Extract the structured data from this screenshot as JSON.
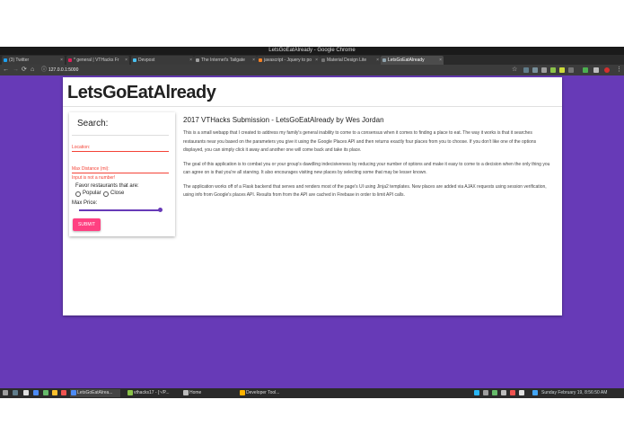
{
  "window": {
    "title": "LetsGoEatAlready - Google Chrome"
  },
  "tabs": [
    {
      "label": "(3) Twitter",
      "active": false
    },
    {
      "label": "* general | VTHacks Fr",
      "active": false
    },
    {
      "label": "Devpost",
      "active": false
    },
    {
      "label": "The Internet's Tailgate",
      "active": false
    },
    {
      "label": "javascript - Jquery to po",
      "active": false
    },
    {
      "label": "Material Design Lite",
      "active": false
    },
    {
      "label": "LetsGoEatAlready",
      "active": true
    }
  ],
  "address": {
    "url": "127.0.0.1:5000"
  },
  "app": {
    "brand": "LetsGoEatAlready"
  },
  "search": {
    "title": "Search:",
    "location_label": "Location:",
    "distance_label": "Max Distance (mi):",
    "distance_error": "Input is not a number!",
    "favor_label": "Favor restaurants that are:",
    "option_popular": "Popular",
    "option_close": "Close",
    "price_label": "Max Price:",
    "price_level": 1.0,
    "submit_label": "SUBMIT"
  },
  "article": {
    "title": "2017 VTHacks Submission - LetsGoEatAlready by Wes Jordan",
    "p1": "This is a small webapp that I created to address my family's general inability to come to a consensus when it comes to finding a place to eat. The way it works is that it searches restaurants near you based on the parameters you give it using the Google Places API and then returns exactly four places from you to choose. If you don't like one of the options displayed, you can simply click it away and another one will come back and take its place.",
    "p2": "The goal of this application is to combat you or your group's dawdling indecisiveness by reducing your number of options and make it easy to come to a decision when the only thing you can agree on is that you're all starving. It also encourages visiting new places by selecting some that may be lesser known.",
    "p3": "The application works off of a Flask backend that serves and renders most of the page's UI using Jinja2 templates. New places are added via AJAX requests using session verification, using info from Google's places API. Results from from the API are cached in Firebase in order to limit API calls."
  },
  "taskbar": {
    "items": [
      "LetsGoEatAlrea...",
      "vthacks17 - [~/P...",
      "Home",
      "Developer Tool..."
    ],
    "clock": "Sunday February 19,  8:56:50 AM"
  },
  "colors": {
    "primary": "#673ab7",
    "accent": "#ff4081",
    "error": "#f44336"
  }
}
